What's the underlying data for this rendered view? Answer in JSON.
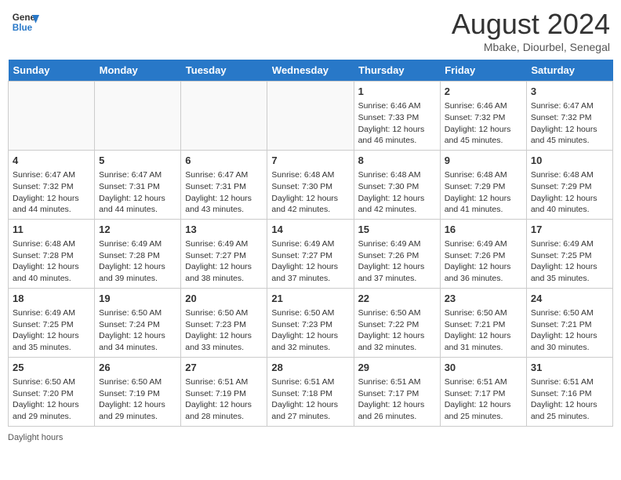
{
  "header": {
    "logo_line1": "General",
    "logo_line2": "Blue",
    "month_year": "August 2024",
    "location": "Mbake, Diourbel, Senegal"
  },
  "days_of_week": [
    "Sunday",
    "Monday",
    "Tuesday",
    "Wednesday",
    "Thursday",
    "Friday",
    "Saturday"
  ],
  "weeks": [
    [
      {
        "day": "",
        "info": ""
      },
      {
        "day": "",
        "info": ""
      },
      {
        "day": "",
        "info": ""
      },
      {
        "day": "",
        "info": ""
      },
      {
        "day": "1",
        "info": "Sunrise: 6:46 AM\nSunset: 7:33 PM\nDaylight: 12 hours and 46 minutes."
      },
      {
        "day": "2",
        "info": "Sunrise: 6:46 AM\nSunset: 7:32 PM\nDaylight: 12 hours and 45 minutes."
      },
      {
        "day": "3",
        "info": "Sunrise: 6:47 AM\nSunset: 7:32 PM\nDaylight: 12 hours and 45 minutes."
      }
    ],
    [
      {
        "day": "4",
        "info": "Sunrise: 6:47 AM\nSunset: 7:32 PM\nDaylight: 12 hours and 44 minutes."
      },
      {
        "day": "5",
        "info": "Sunrise: 6:47 AM\nSunset: 7:31 PM\nDaylight: 12 hours and 44 minutes."
      },
      {
        "day": "6",
        "info": "Sunrise: 6:47 AM\nSunset: 7:31 PM\nDaylight: 12 hours and 43 minutes."
      },
      {
        "day": "7",
        "info": "Sunrise: 6:48 AM\nSunset: 7:30 PM\nDaylight: 12 hours and 42 minutes."
      },
      {
        "day": "8",
        "info": "Sunrise: 6:48 AM\nSunset: 7:30 PM\nDaylight: 12 hours and 42 minutes."
      },
      {
        "day": "9",
        "info": "Sunrise: 6:48 AM\nSunset: 7:29 PM\nDaylight: 12 hours and 41 minutes."
      },
      {
        "day": "10",
        "info": "Sunrise: 6:48 AM\nSunset: 7:29 PM\nDaylight: 12 hours and 40 minutes."
      }
    ],
    [
      {
        "day": "11",
        "info": "Sunrise: 6:48 AM\nSunset: 7:28 PM\nDaylight: 12 hours and 40 minutes."
      },
      {
        "day": "12",
        "info": "Sunrise: 6:49 AM\nSunset: 7:28 PM\nDaylight: 12 hours and 39 minutes."
      },
      {
        "day": "13",
        "info": "Sunrise: 6:49 AM\nSunset: 7:27 PM\nDaylight: 12 hours and 38 minutes."
      },
      {
        "day": "14",
        "info": "Sunrise: 6:49 AM\nSunset: 7:27 PM\nDaylight: 12 hours and 37 minutes."
      },
      {
        "day": "15",
        "info": "Sunrise: 6:49 AM\nSunset: 7:26 PM\nDaylight: 12 hours and 37 minutes."
      },
      {
        "day": "16",
        "info": "Sunrise: 6:49 AM\nSunset: 7:26 PM\nDaylight: 12 hours and 36 minutes."
      },
      {
        "day": "17",
        "info": "Sunrise: 6:49 AM\nSunset: 7:25 PM\nDaylight: 12 hours and 35 minutes."
      }
    ],
    [
      {
        "day": "18",
        "info": "Sunrise: 6:49 AM\nSunset: 7:25 PM\nDaylight: 12 hours and 35 minutes."
      },
      {
        "day": "19",
        "info": "Sunrise: 6:50 AM\nSunset: 7:24 PM\nDaylight: 12 hours and 34 minutes."
      },
      {
        "day": "20",
        "info": "Sunrise: 6:50 AM\nSunset: 7:23 PM\nDaylight: 12 hours and 33 minutes."
      },
      {
        "day": "21",
        "info": "Sunrise: 6:50 AM\nSunset: 7:23 PM\nDaylight: 12 hours and 32 minutes."
      },
      {
        "day": "22",
        "info": "Sunrise: 6:50 AM\nSunset: 7:22 PM\nDaylight: 12 hours and 32 minutes."
      },
      {
        "day": "23",
        "info": "Sunrise: 6:50 AM\nSunset: 7:21 PM\nDaylight: 12 hours and 31 minutes."
      },
      {
        "day": "24",
        "info": "Sunrise: 6:50 AM\nSunset: 7:21 PM\nDaylight: 12 hours and 30 minutes."
      }
    ],
    [
      {
        "day": "25",
        "info": "Sunrise: 6:50 AM\nSunset: 7:20 PM\nDaylight: 12 hours and 29 minutes."
      },
      {
        "day": "26",
        "info": "Sunrise: 6:50 AM\nSunset: 7:19 PM\nDaylight: 12 hours and 29 minutes."
      },
      {
        "day": "27",
        "info": "Sunrise: 6:51 AM\nSunset: 7:19 PM\nDaylight: 12 hours and 28 minutes."
      },
      {
        "day": "28",
        "info": "Sunrise: 6:51 AM\nSunset: 7:18 PM\nDaylight: 12 hours and 27 minutes."
      },
      {
        "day": "29",
        "info": "Sunrise: 6:51 AM\nSunset: 7:17 PM\nDaylight: 12 hours and 26 minutes."
      },
      {
        "day": "30",
        "info": "Sunrise: 6:51 AM\nSunset: 7:17 PM\nDaylight: 12 hours and 25 minutes."
      },
      {
        "day": "31",
        "info": "Sunrise: 6:51 AM\nSunset: 7:16 PM\nDaylight: 12 hours and 25 minutes."
      }
    ]
  ],
  "footer": {
    "daylight_label": "Daylight hours"
  }
}
